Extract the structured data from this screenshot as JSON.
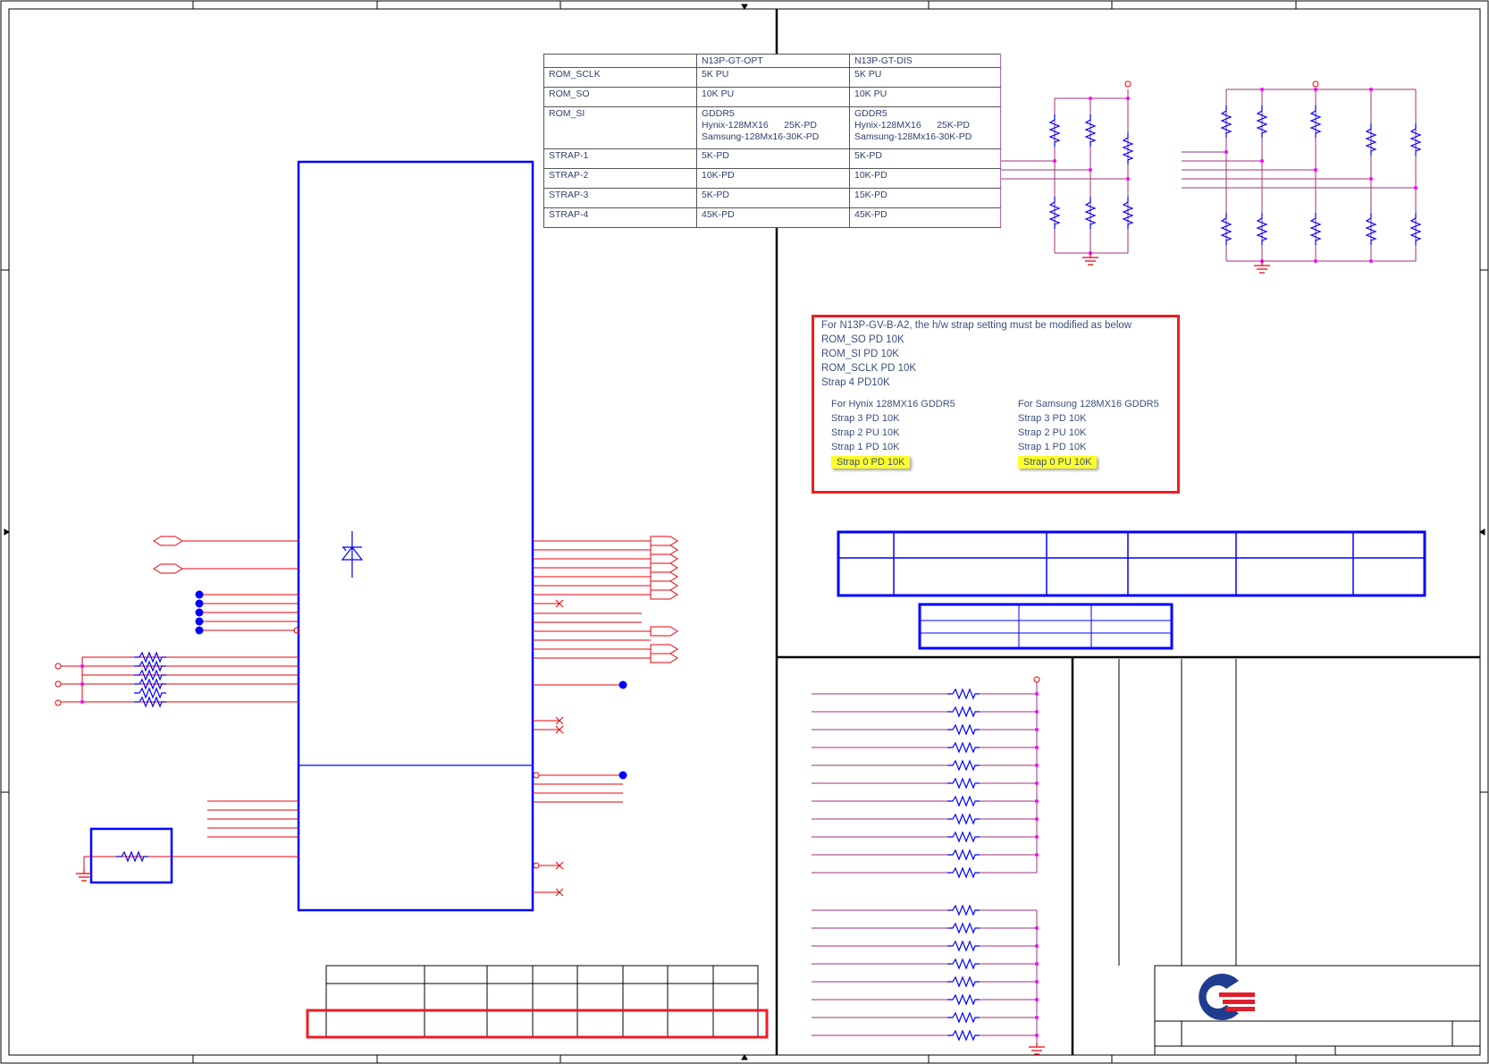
{
  "strap_table": {
    "header": [
      "",
      "N13P-GT-OPT",
      "N13P-GT-DIS"
    ],
    "rows": [
      {
        "name": "ROM_SCLK",
        "opt": "5K PU",
        "dis": "5K PU"
      },
      {
        "name": "ROM_SO",
        "opt": "10K PU",
        "dis": "10K PU"
      },
      {
        "name": "ROM_SI",
        "opt": "GDDR5\nHynix-128MX16      25K-PD\nSamsung-128Mx16-30K-PD",
        "dis": "GDDR5\nHynix-128MX16      25K-PD\nSamsung-128Mx16-30K-PD"
      },
      {
        "name": "STRAP-1",
        "opt": "5K-PD",
        "dis": "5K-PD"
      },
      {
        "name": "STRAP-2",
        "opt": "10K-PD",
        "dis": "10K-PD"
      },
      {
        "name": "STRAP-3",
        "opt": "5K-PD",
        "dis": "15K-PD"
      },
      {
        "name": "STRAP-4",
        "opt": "45K-PD",
        "dis": "45K-PD"
      }
    ]
  },
  "note": {
    "title": "For N13P-GV-B-A2, the h/w strap setting must be modified as below",
    "lines": [
      "ROM_SO PD 10K",
      "ROM_SI PD 10K",
      "ROM_SCLK PD 10K",
      "Strap 4  PD10K"
    ],
    "hynix": {
      "heading": "For Hynix 128MX16 GDDR5",
      "items": [
        "Strap 3 PD 10K",
        "Strap 2 PU 10K",
        "Strap 1 PD 10K"
      ],
      "highlight": "Strap 0 PD 10K"
    },
    "samsung": {
      "heading": "For Samsung 128MX16 GDDR5",
      "items": [
        "Strap 3 PD 10K",
        "Strap 2 PU 10K",
        "Strap 1 PD 10K"
      ],
      "highlight": "Strap 0 PU 10K"
    }
  },
  "colors": {
    "border": "#000000",
    "wire": "#e8000b",
    "bus_wire": "#a0307a",
    "component": "#0000ff",
    "junction": "#ff00ff",
    "highlight": "#ffff2a",
    "note_border": "#ee1c24",
    "note_text": "#3a4f80",
    "logo_blue": "#1f3d8f",
    "logo_red": "#e01e2a"
  },
  "icons": [
    "ground-icon",
    "resistor-icon",
    "diode-icon",
    "power-flag-icon",
    "company-logo-icon"
  ]
}
